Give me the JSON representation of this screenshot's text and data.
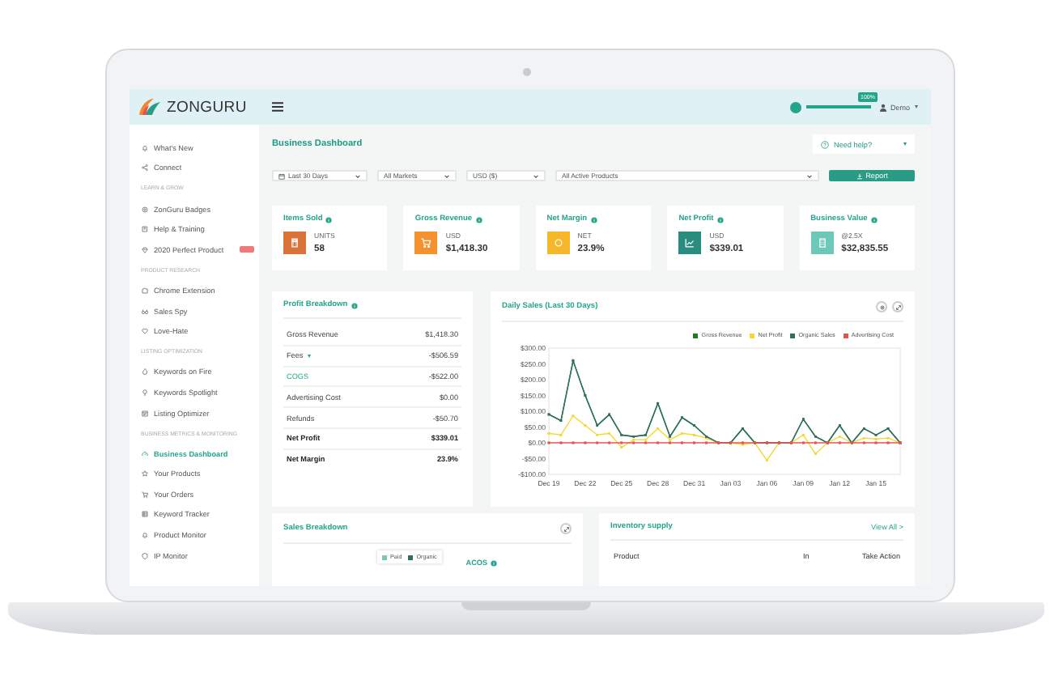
{
  "topbar": {
    "logo": "ZONGURU",
    "progress": {
      "level": 1,
      "badge": "100%"
    },
    "user": "Demo"
  },
  "sidebar": {
    "items": [
      {
        "kind": "link",
        "label": "What's New",
        "selected": false,
        "tagged": false
      },
      {
        "kind": "link",
        "label": "Connect",
        "selected": false,
        "tagged": false
      },
      {
        "kind": "header",
        "label": "LEARN & GROW"
      },
      {
        "kind": "link",
        "label": "ZonGuru Badges",
        "selected": false,
        "tagged": false
      },
      {
        "kind": "link",
        "label": "Help & Training",
        "selected": false,
        "tagged": false
      },
      {
        "kind": "link",
        "label": "2020 Perfect Product",
        "selected": false,
        "tagged": true
      },
      {
        "kind": "header",
        "label": "PRODUCT RESEARCH"
      },
      {
        "kind": "link",
        "label": "Chrome Extension",
        "selected": false,
        "tagged": false
      },
      {
        "kind": "link",
        "label": "Sales Spy",
        "selected": false,
        "tagged": false
      },
      {
        "kind": "link",
        "label": "Love-Hate",
        "selected": false,
        "tagged": false
      },
      {
        "kind": "header",
        "label": "LISTING OPTIMIZATION"
      },
      {
        "kind": "link",
        "label": "Keywords on Fire",
        "selected": false,
        "tagged": false
      },
      {
        "kind": "link",
        "label": "Keywords Spotlight",
        "selected": false,
        "tagged": false
      },
      {
        "kind": "link",
        "label": "Listing Optimizer",
        "selected": false,
        "tagged": false
      },
      {
        "kind": "header",
        "label": "BUSINESS METRICS & MONITORING"
      },
      {
        "kind": "link",
        "label": "Business Dashboard",
        "selected": true,
        "tagged": false
      },
      {
        "kind": "link",
        "label": "Your Products",
        "selected": false,
        "tagged": false
      },
      {
        "kind": "link",
        "label": "Your Orders",
        "selected": false,
        "tagged": false
      },
      {
        "kind": "link",
        "label": "Keyword Tracker",
        "selected": false,
        "tagged": false
      },
      {
        "kind": "link",
        "label": "Product Monitor",
        "selected": false,
        "tagged": false
      },
      {
        "kind": "link",
        "label": "IP Monitor",
        "selected": false,
        "tagged": false
      }
    ]
  },
  "page": {
    "title": "Business Dashboard",
    "help_button": "Need help?"
  },
  "filters": {
    "period": "Last 30 Days",
    "market": "All Markets",
    "currency": "USD ($)",
    "products": "All Active Products",
    "report_button": "Report"
  },
  "kpis": [
    {
      "title": "Items Sold",
      "unit": "UNITS",
      "value": "58",
      "color": "#d9733a"
    },
    {
      "title": "Gross Revenue",
      "unit": "USD",
      "value": "$1,418.30",
      "color": "#f5922f"
    },
    {
      "title": "Net Margin",
      "unit": "NET",
      "value": "23.9%",
      "color": "#f6b82a"
    },
    {
      "title": "Net Profit",
      "unit": "USD",
      "value": "$339.01",
      "color": "#2a8c7e"
    },
    {
      "title": "Business Value",
      "unit": "@2.5X",
      "value": "$32,835.55",
      "color": "#6cc9b9"
    }
  ],
  "profit_breakdown": {
    "title": "Profit Breakdown",
    "rows": [
      {
        "kind": "plain",
        "label": "Gross Revenue",
        "value": "$1,418.30"
      },
      {
        "kind": "dropdown",
        "label": "Fees",
        "value": "-$506.59"
      },
      {
        "kind": "link",
        "label": "COGS",
        "value": "-$522.00"
      },
      {
        "kind": "plain",
        "label": "Advertising Cost",
        "value": "$0.00"
      },
      {
        "kind": "plain",
        "label": "Refunds",
        "value": "-$50.70"
      },
      {
        "kind": "total",
        "label": "Net Profit",
        "value": "$339.01"
      },
      {
        "kind": "total",
        "label": "Net Margin",
        "value": "23.9%"
      }
    ]
  },
  "daily_sales": {
    "chart_data": {
      "type": "line",
      "title": "Daily Sales (Last 30 Days)",
      "categories": [
        "Dec 19",
        null,
        null,
        "Dec 22",
        null,
        null,
        "Dec 25",
        null,
        null,
        "Dec 28",
        null,
        null,
        "Dec 31",
        null,
        null,
        "Jan 03",
        null,
        null,
        "Jan 06",
        null,
        null,
        "Jan 09",
        null,
        null,
        "Jan 12",
        null,
        null,
        "Jan 15",
        null,
        null
      ],
      "series": [
        {
          "name": "Gross Revenue",
          "color": "#1e7b1e",
          "values": [
            90,
            70,
            260,
            150,
            55,
            90,
            25,
            20,
            25,
            125,
            20,
            80,
            55,
            20,
            0,
            0,
            45,
            0,
            0,
            0,
            0,
            75,
            20,
            0,
            55,
            0,
            45,
            25,
            45,
            0
          ]
        },
        {
          "name": "Net Profit",
          "color": "#f5d836",
          "values": [
            30,
            25,
            85,
            55,
            25,
            30,
            -15,
            10,
            10,
            45,
            10,
            30,
            25,
            15,
            0,
            0,
            -5,
            0,
            -55,
            0,
            0,
            25,
            -35,
            0,
            20,
            0,
            15,
            12,
            15,
            0
          ]
        },
        {
          "name": "Organic Sales",
          "color": "#2f6f62",
          "values": [
            90,
            70,
            260,
            150,
            55,
            90,
            25,
            20,
            25,
            125,
            20,
            80,
            55,
            20,
            0,
            0,
            45,
            0,
            0,
            0,
            0,
            75,
            20,
            0,
            55,
            0,
            45,
            25,
            45,
            0
          ]
        },
        {
          "name": "Advertising Cost",
          "color": "#e0574f",
          "values": [
            0,
            0,
            0,
            0,
            0,
            0,
            0,
            0,
            0,
            0,
            0,
            0,
            0,
            0,
            0,
            0,
            0,
            0,
            0,
            0,
            0,
            0,
            0,
            0,
            0,
            0,
            0,
            0,
            0,
            0
          ]
        }
      ],
      "ylim": [
        -100,
        300
      ],
      "yticks": [
        {
          "value": 300,
          "label": "$300.00"
        },
        {
          "value": 250,
          "label": "$250.00"
        },
        {
          "value": 200,
          "label": "$200.00"
        },
        {
          "value": 150,
          "label": "$150.00"
        },
        {
          "value": 100,
          "label": "$100.00"
        },
        {
          "value": 50,
          "label": "$50.00"
        },
        {
          "value": 0,
          "label": "$0.00"
        },
        {
          "value": -50,
          "label": "-$50.00"
        },
        {
          "value": -100,
          "label": "-$100.00"
        }
      ]
    }
  },
  "sales_breakdown": {
    "title": "Sales Breakdown",
    "legend": [
      {
        "label": "Paid",
        "color": "#7dc7b8"
      },
      {
        "label": "Organic",
        "color": "#2f6f62"
      }
    ],
    "metric": "ACOS"
  },
  "inventory": {
    "title": "Inventory supply",
    "link": "View All >",
    "columns": [
      "Product",
      "In",
      "Take Action"
    ]
  }
}
